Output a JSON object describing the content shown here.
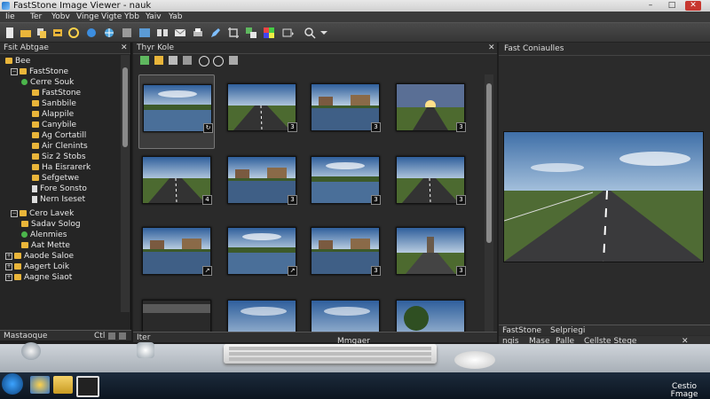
{
  "window": {
    "title": "FastStone Image Viewer - nauk"
  },
  "menubar": {
    "items": [
      "Iie",
      "Ter",
      "Yobv",
      "Vinge",
      "Vigte",
      "Ybb",
      "Yaiv",
      "Yab"
    ]
  },
  "left_pane": {
    "header": "Fsit Abtgae",
    "tree": [
      {
        "label": "Bee",
        "kind": "folder",
        "expand": "",
        "level": 0
      },
      {
        "label": "FastStone",
        "kind": "folder",
        "expand": "−",
        "level": 1
      },
      {
        "label": "Cerre Souk",
        "kind": "green",
        "expand": "",
        "level": 2
      },
      {
        "label": "FastStone",
        "kind": "folder",
        "expand": "",
        "level": 3
      },
      {
        "label": "Sanbbile",
        "kind": "folder",
        "expand": "",
        "level": 3
      },
      {
        "label": "Alappile",
        "kind": "folder",
        "expand": "",
        "level": 3
      },
      {
        "label": "Canybile",
        "kind": "folder",
        "expand": "",
        "level": 3
      },
      {
        "label": "Ag Cortatill",
        "kind": "folder",
        "expand": "",
        "level": 3
      },
      {
        "label": "Air Clenints",
        "kind": "folder",
        "expand": "",
        "level": 3
      },
      {
        "label": "Siz 2 Stobs",
        "kind": "folder",
        "expand": "",
        "level": 3
      },
      {
        "label": "Ha Eisrarerk",
        "kind": "folder",
        "expand": "",
        "level": 3
      },
      {
        "label": "Sefgetwe",
        "kind": "folder",
        "expand": "",
        "level": 3
      },
      {
        "label": "Fore Sonsto",
        "kind": "doc",
        "expand": "",
        "level": 3
      },
      {
        "label": "Nern Iseset",
        "kind": "doc",
        "expand": "",
        "level": 3
      },
      {
        "label": "Cero Lavek",
        "kind": "folder",
        "expand": "−",
        "level": 1
      },
      {
        "label": "Sadav Solog",
        "kind": "folder",
        "expand": "",
        "level": 2
      },
      {
        "label": "Alenmies",
        "kind": "green",
        "expand": "",
        "level": 2
      },
      {
        "label": "Aat Mette",
        "kind": "folder",
        "expand": "",
        "level": 2
      },
      {
        "label": "Aaode Saloe",
        "kind": "folder",
        "expand": "+",
        "level": 0
      },
      {
        "label": "Aagert Loik",
        "kind": "folder",
        "expand": "+",
        "level": 0
      },
      {
        "label": "Aagne Siaot",
        "kind": "folder",
        "expand": "+",
        "level": 0
      }
    ],
    "status_left": "Mastaoque",
    "status_right": "Ctl"
  },
  "center_pane": {
    "header": "Thyr Kole",
    "status": "Iter",
    "thumbs": [
      {
        "scene": "lake",
        "badge": "↻",
        "selected": true
      },
      {
        "scene": "road",
        "badge": "3",
        "selected": false
      },
      {
        "scene": "town",
        "badge": "3",
        "selected": false
      },
      {
        "scene": "sunset",
        "badge": "3",
        "selected": false
      },
      {
        "scene": "road",
        "badge": "4",
        "selected": false
      },
      {
        "scene": "town",
        "badge": "3",
        "selected": false
      },
      {
        "scene": "lake",
        "badge": "3",
        "selected": false
      },
      {
        "scene": "road",
        "badge": "3",
        "selected": false
      },
      {
        "scene": "town",
        "badge": "↗",
        "selected": false
      },
      {
        "scene": "lake",
        "badge": "↗",
        "selected": false
      },
      {
        "scene": "town",
        "badge": "3",
        "selected": false
      },
      {
        "scene": "tower",
        "badge": "3",
        "selected": false
      },
      {
        "scene": "dark",
        "badge": "",
        "selected": false
      },
      {
        "scene": "sky",
        "badge": "",
        "selected": false
      },
      {
        "scene": "sky",
        "badge": "",
        "selected": false
      },
      {
        "scene": "tree",
        "badge": "",
        "selected": false
      }
    ]
  },
  "right_pane": {
    "header": "Fast Coniaulles",
    "tabs": [
      "FastStone",
      "Selpriegi"
    ],
    "bottom_items": [
      "ngis",
      "Mase",
      "Palle",
      "Cellste Stege"
    ]
  },
  "desk": {
    "monitor_label": "Mmgaer"
  },
  "taskbar": {
    "clock_line1": "Cestio",
    "clock_line2": "Fmage"
  },
  "colors": {
    "accent": "#e9b53a",
    "panel": "#252525",
    "selection": "#3d3d3d"
  }
}
